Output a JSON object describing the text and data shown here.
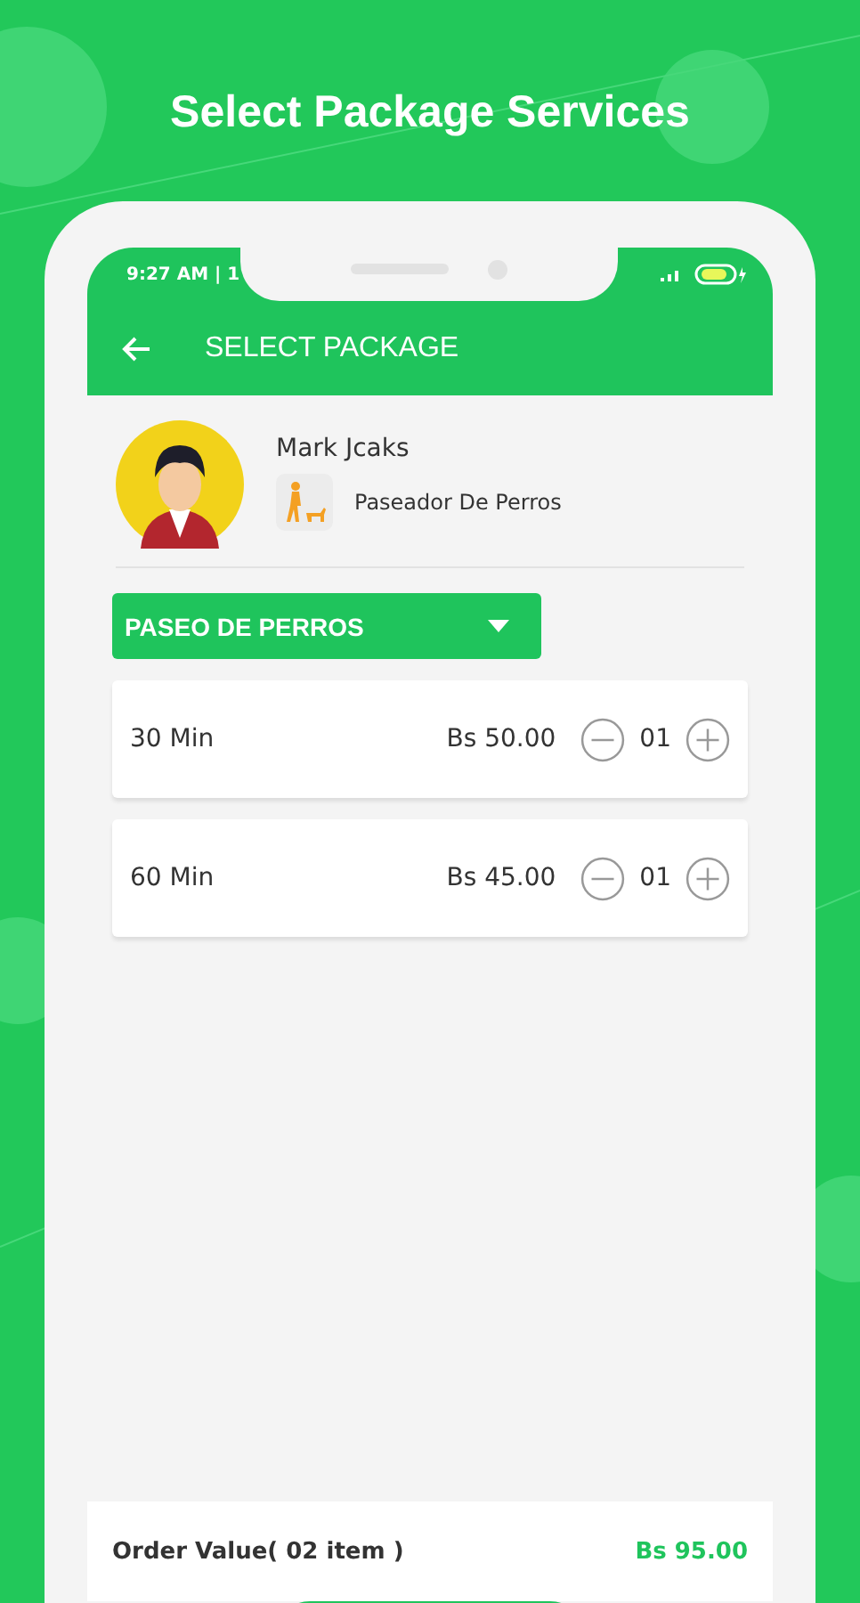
{
  "headline": "Select Package Services",
  "status_bar": {
    "time": "9:27 AM | 1"
  },
  "app_bar": {
    "title": "SELECT PACKAGE"
  },
  "provider": {
    "name": "Mark Jcaks",
    "role": "Paseador De Perros"
  },
  "category_dropdown": {
    "value": "PASEO DE PERROS"
  },
  "packages": [
    {
      "duration": "30 Min",
      "price": "Bs 50.00",
      "quantity": "01"
    },
    {
      "duration": "60 Min",
      "price": "Bs 45.00",
      "quantity": "01"
    }
  ],
  "order": {
    "label": "Order Value( 02 item )",
    "total": "Bs 95.00"
  }
}
